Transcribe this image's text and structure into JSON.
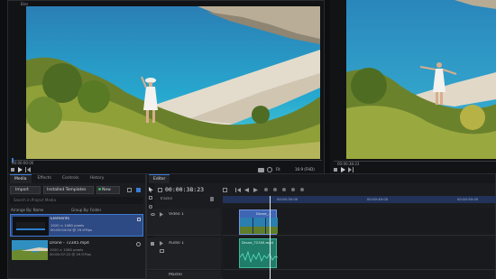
{
  "viewer_left": {
    "title": "Bins",
    "timecode": "00:00:00:00",
    "zoom": "Fit",
    "aspect": "16:9 (FHD)"
  },
  "viewer_right": {
    "timecode": "00:00:38:23"
  },
  "media_panel": {
    "tabs": [
      "Media",
      "Effects",
      "Controls",
      "History"
    ],
    "import_label": "Import",
    "templates_label": "Installed Templates",
    "new_label": "New",
    "search_placeholder": "Search in Project Media",
    "arrange_label": "Arrange By: Name",
    "group_label": "Group By: Folder",
    "items": [
      {
        "name": "Elements",
        "line1": "1920 × 1080 pixels",
        "line2": "00:00:04:04 @ 29.97fps",
        "selected": true
      },
      {
        "name": "Drone - 72345.mp4",
        "line1": "1920 × 1080 pixels",
        "line2": "00:00:37:22 @ 29.97fps",
        "selected": false
      }
    ]
  },
  "timeline": {
    "tab": "Editor",
    "timecode": "00:00:38:23",
    "tracks_label": "Tracks",
    "ruler_marks": [
      "00:00:30:00",
      "00:00:40:00",
      "00:00:50:00"
    ],
    "tracks": [
      {
        "name": "Video 1",
        "clip": "Drone_..."
      },
      {
        "name": "Audio 1",
        "clip": "Drone_72345.mp4"
      },
      {
        "name": "Master"
      }
    ]
  },
  "colors": {
    "accent": "#3a7bd5",
    "video_clip": "#3f66b4",
    "audio_clip": "#1f7d6a",
    "sea": "#2aa3c9"
  }
}
